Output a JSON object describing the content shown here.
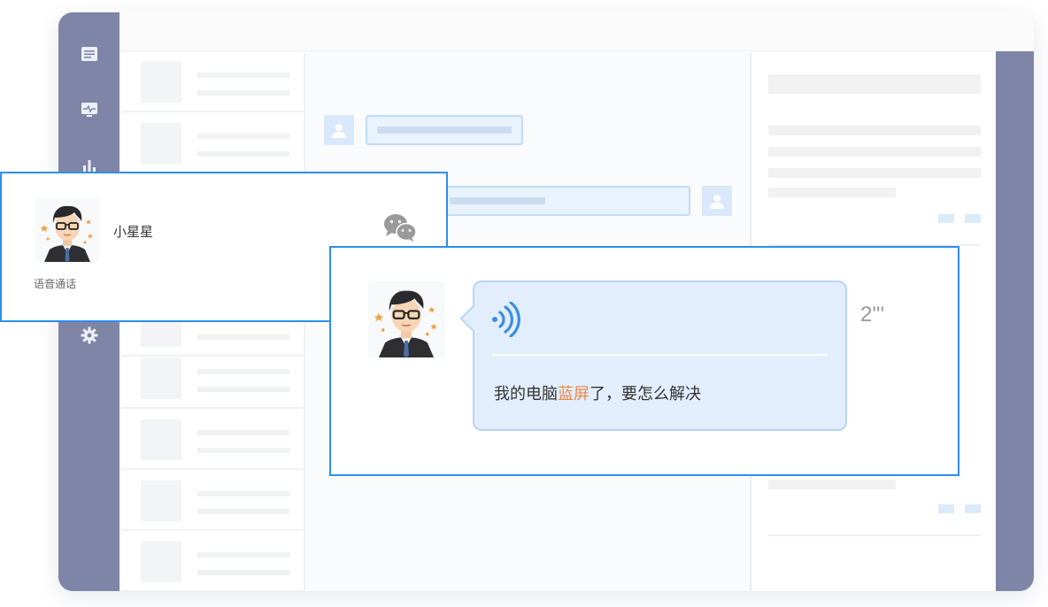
{
  "call_card": {
    "caller_name": "小星星",
    "call_type": "语音通话",
    "channel_icon": "wechat-icon"
  },
  "message_card": {
    "transcript_before": "我的电脑",
    "transcript_highlight": "蓝屏",
    "transcript_after": "了，要怎么解决",
    "duration": "2'''",
    "voice_icon": "voice-wave-icon"
  },
  "sidebar": {
    "icons": [
      "document-icon",
      "monitor-icon",
      "bar-chart-icon",
      "settings-icon"
    ]
  },
  "colors": {
    "accent_blue": "#2e8ef0",
    "sidebar": "#7e85a6",
    "highlight_orange": "#e8884a",
    "bubble_bg": "#e2eefd"
  }
}
